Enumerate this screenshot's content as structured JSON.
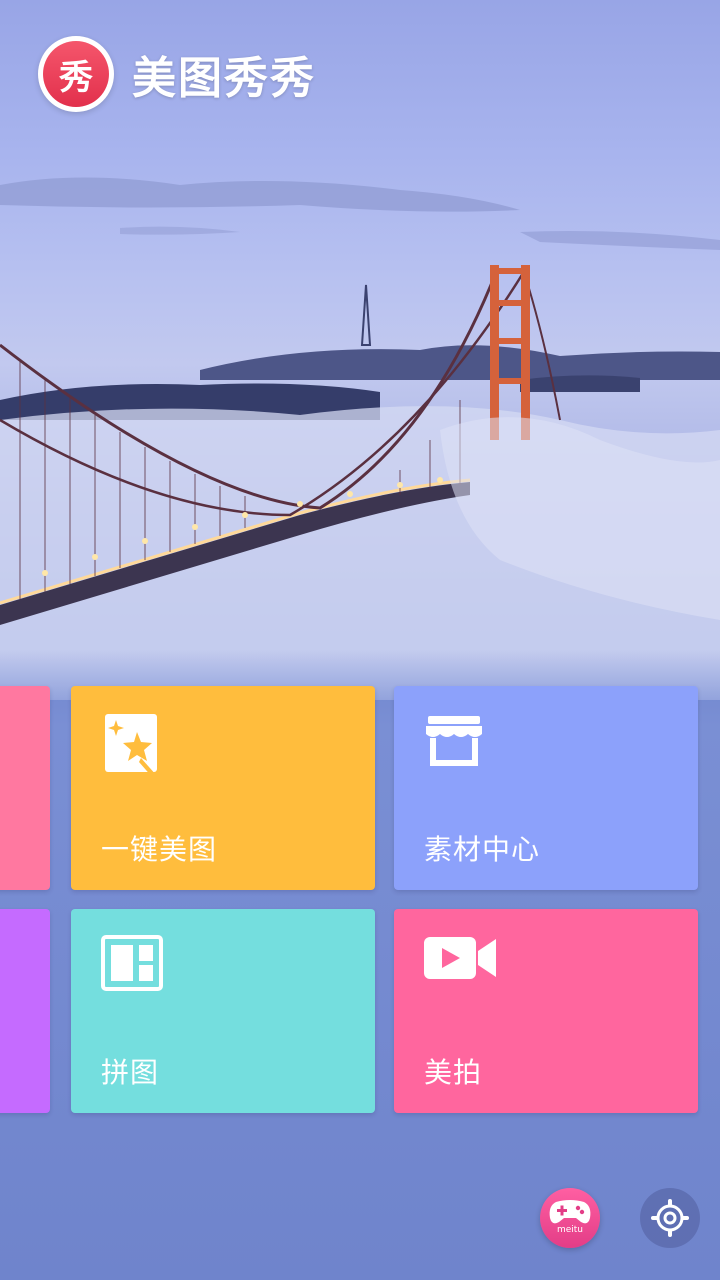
{
  "app": {
    "logo_badge_text": "秀",
    "logo_text": "美图秀秀"
  },
  "tiles": [
    {
      "label": "一键美图",
      "icon": "magic-wand-icon",
      "color": "#ffbd3d"
    },
    {
      "label": "素材中心",
      "icon": "store-icon",
      "color": "#8ca1fb"
    },
    {
      "label": "拼图",
      "icon": "collage-icon",
      "color": "#74dede"
    },
    {
      "label": "美拍",
      "icon": "video-camera-icon",
      "color": "#ff669e"
    }
  ],
  "side_tiles": [
    {
      "color": "#ff78a0"
    },
    {
      "color": "#c56bff"
    }
  ],
  "footer": {
    "game_badge_text": "meitu",
    "game_icon": "gamepad-icon",
    "settings_icon": "gear-icon"
  }
}
